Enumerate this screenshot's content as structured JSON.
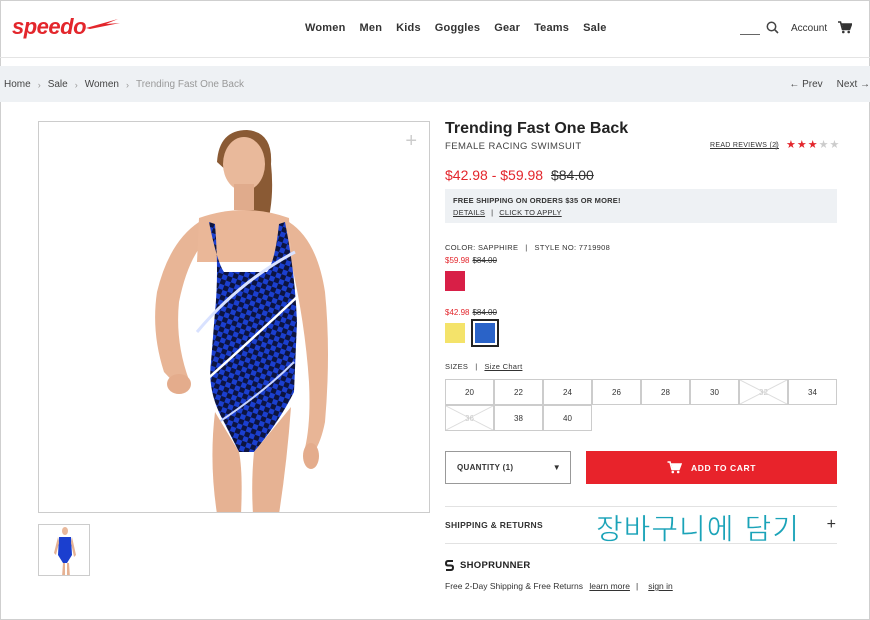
{
  "brand": {
    "logo_text": "speedo",
    "logo_color": "#e3262c"
  },
  "nav": {
    "items": [
      "Women",
      "Men",
      "Kids",
      "Goggles",
      "Gear",
      "Teams",
      "Sale"
    ]
  },
  "header": {
    "account_label": "Account"
  },
  "breadcrumb": {
    "items": [
      "Home",
      "Sale",
      "Women"
    ],
    "current": "Trending Fast One Back",
    "prev": "Prev",
    "next": "Next"
  },
  "product": {
    "title": "Trending Fast One Back",
    "subtitle": "FEMALE RACING SWIMSUIT",
    "reviews_label": "READ REVIEWS (2)",
    "rating": 3,
    "rating_max": 5,
    "price_range": "$42.98 - $59.98",
    "price_original": "$84.00",
    "shipping": {
      "title": "FREE SHIPPING ON ORDERS $35 OR MORE!",
      "details": "DETAILS",
      "apply": "CLICK TO APPLY"
    },
    "color_label": "COLOR: SAPPHIRE",
    "style_label": "STYLE NO: 7719908",
    "price_groups": [
      {
        "sale": "$59.98",
        "was": "$84.00",
        "swatches": [
          "#d81f47"
        ]
      },
      {
        "sale": "$42.98",
        "was": "$84.00",
        "swatches": [
          "#f4e36a",
          "#2a63c8"
        ]
      }
    ],
    "sizes_label": "SIZES",
    "size_chart": "Size Chart",
    "sizes": [
      {
        "label": "20",
        "available": true
      },
      {
        "label": "22",
        "available": true
      },
      {
        "label": "24",
        "available": true
      },
      {
        "label": "26",
        "available": true
      },
      {
        "label": "28",
        "available": true
      },
      {
        "label": "30",
        "available": true
      },
      {
        "label": "32",
        "available": false
      },
      {
        "label": "34",
        "available": true
      },
      {
        "label": "36",
        "available": false
      },
      {
        "label": "38",
        "available": true
      },
      {
        "label": "40",
        "available": true
      }
    ],
    "quantity_label": "QUANTITY (1)",
    "add_to_cart": "ADD TO CART",
    "shipping_returns": "SHIPPING & RETURNS",
    "shoprunner": "SHOPRUNNER",
    "shoprunner_text": "Free 2-Day Shipping & Free Returns",
    "learn_more": "learn more",
    "sign_in": "sign in"
  },
  "overlay_text": "장바구니에 담기"
}
